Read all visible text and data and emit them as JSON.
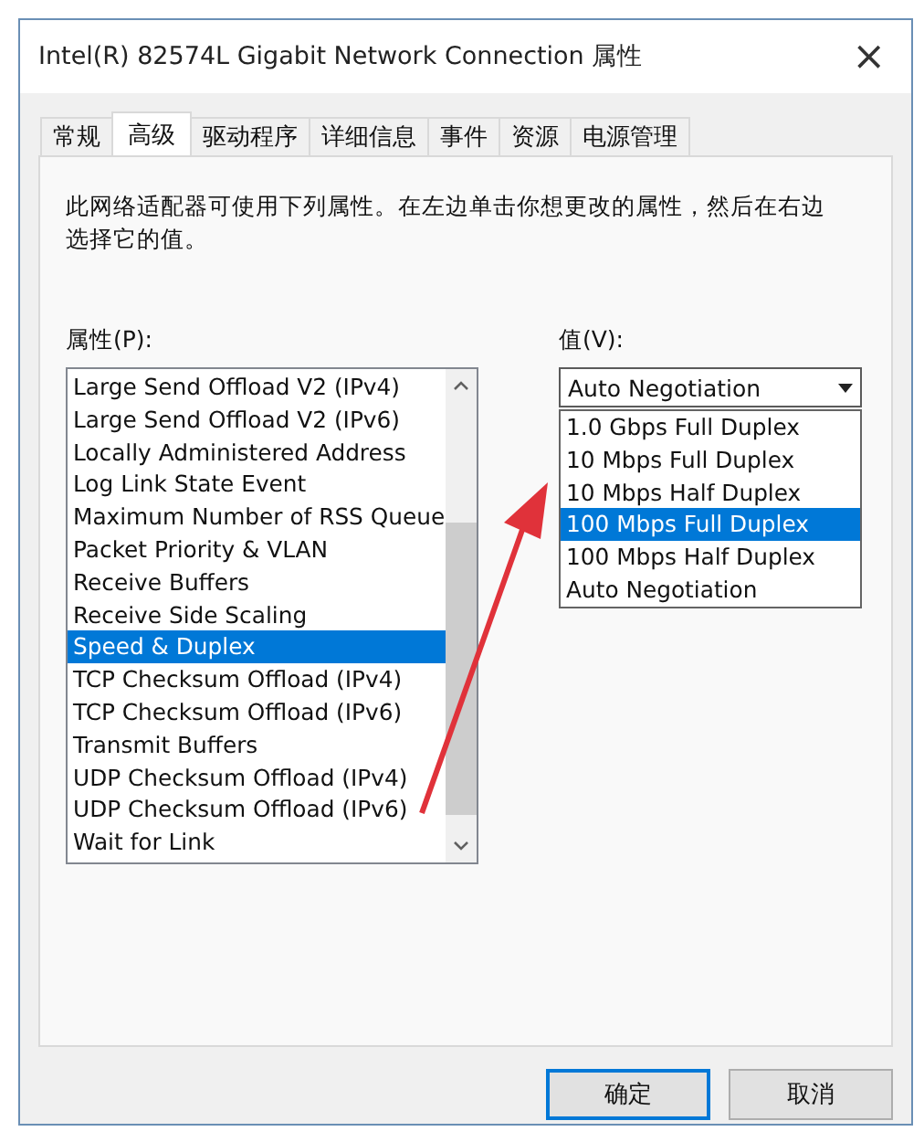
{
  "window": {
    "title": "Intel(R) 82574L Gigabit Network Connection 属性",
    "close": "×"
  },
  "tabs": [
    {
      "label": "常规",
      "selected": false
    },
    {
      "label": "高级",
      "selected": true
    },
    {
      "label": "驱动程序",
      "selected": false
    },
    {
      "label": "详细信息",
      "selected": false
    },
    {
      "label": "事件",
      "selected": false
    },
    {
      "label": "资源",
      "selected": false
    },
    {
      "label": "电源管理",
      "selected": false
    }
  ],
  "description": "此网络适配器可使用下列属性。在左边单击你想更改的属性，然后在右边选择它的值。",
  "property_label": "属性(P):",
  "properties": [
    {
      "label": "Large Send Offload V2 (IPv4)",
      "selected": false
    },
    {
      "label": "Large Send Offload V2 (IPv6)",
      "selected": false
    },
    {
      "label": "Locally Administered Address",
      "selected": false
    },
    {
      "label": "Log Link State Event",
      "selected": false
    },
    {
      "label": "Maximum Number of RSS Queue",
      "selected": false
    },
    {
      "label": "Packet Priority & VLAN",
      "selected": false
    },
    {
      "label": "Receive Buffers",
      "selected": false
    },
    {
      "label": "Receive Side Scaling",
      "selected": false
    },
    {
      "label": "Speed & Duplex",
      "selected": true
    },
    {
      "label": "TCP Checksum Offload (IPv4)",
      "selected": false
    },
    {
      "label": "TCP Checksum Offload (IPv6)",
      "selected": false
    },
    {
      "label": "Transmit Buffers",
      "selected": false
    },
    {
      "label": "UDP Checksum Offload (IPv4)",
      "selected": false
    },
    {
      "label": "UDP Checksum Offload (IPv6)",
      "selected": false
    },
    {
      "label": "Wait for Link",
      "selected": false
    }
  ],
  "value_label": "值(V):",
  "value_select": {
    "value": "Auto Negotiation",
    "expanded": true
  },
  "value_options": [
    {
      "label": "1.0 Gbps Full Duplex",
      "selected": false
    },
    {
      "label": "10 Mbps Full Duplex",
      "selected": false
    },
    {
      "label": "10 Mbps Half Duplex",
      "selected": false
    },
    {
      "label": "100 Mbps Full Duplex",
      "selected": true
    },
    {
      "label": "100 Mbps Half Duplex",
      "selected": false
    },
    {
      "label": "Auto Negotiation",
      "selected": false
    }
  ],
  "buttons": [
    {
      "label": "确定",
      "kind": "default"
    },
    {
      "label": "取消",
      "kind": "normal"
    }
  ]
}
